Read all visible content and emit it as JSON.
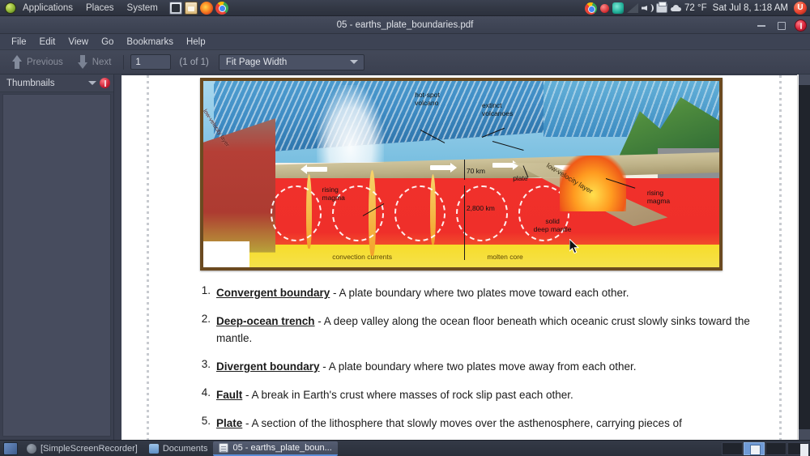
{
  "desktop_panel": {
    "menus": [
      "Applications",
      "Places",
      "System"
    ],
    "launchers": [
      "terminal-icon",
      "file-manager-icon",
      "firefox-icon",
      "chrome-icon"
    ],
    "tray_icons": [
      "chrome-icon",
      "recorder-icon",
      "sync-icon",
      "network-icon",
      "volume-icon",
      "printer-icon",
      "weather-cloud-icon"
    ],
    "temperature": "72 °F",
    "clock": "Sat Jul 8, 1:18 AM",
    "user_indicator": "U"
  },
  "window": {
    "title": "05 - earths_plate_boundaries.pdf",
    "controls": {
      "minimize": "minimize-button",
      "maximize": "maximize-button",
      "close": "close-button"
    }
  },
  "menubar": {
    "items": [
      "File",
      "Edit",
      "View",
      "Go",
      "Bookmarks",
      "Help"
    ]
  },
  "toolbar": {
    "previous_label": "Previous",
    "next_label": "Next",
    "page_value": "1",
    "page_placeholder": "1",
    "page_count": "(1 of 1)",
    "zoom_value": "Fit Page Width"
  },
  "sidebar": {
    "title": "Thumbnails",
    "dropdown": "chevron-down-icon",
    "close": "close-sidebar-button"
  },
  "document": {
    "figure": {
      "labels": [
        "hot-spot volcano",
        "extinct volcanoes",
        "low-velocity layer",
        "rising magma",
        "70 km",
        "2,800 km",
        "plate",
        "solid deep mantle",
        "rising magma",
        "convection currents",
        "molten core"
      ],
      "label_hotspot": "hot-spot\nvolcano",
      "label_extinct": "extinct\nvolcanoes",
      "label_lowvel_left": "low-velocity layer",
      "label_lowvel_right": "low-velocity layer",
      "label_rising_left": "rising\nmagma",
      "label_rising_right": "rising\nmagma",
      "label_70km": "70 km",
      "label_2800km": "2,800 km",
      "label_plate": "plate",
      "label_deepmantle": "solid\ndeep mantle",
      "label_convection": "convection currents",
      "label_molten": "molten core"
    },
    "list": [
      {
        "number": "1.",
        "term": "Convergent boundary",
        "definition": " - A plate boundary where two plates move toward each other."
      },
      {
        "number": "2.",
        "term": "Deep-ocean trench",
        "definition": " - A deep valley along the ocean floor beneath which oceanic crust slowly sinks toward the mantle."
      },
      {
        "number": "3.",
        "term": "Divergent boundary",
        "definition": " - A plate boundary where two plates move away from each other."
      },
      {
        "number": "4.",
        "term": "Fault",
        "definition": " - A break in Earth's crust where masses of rock slip past each other."
      },
      {
        "number": "5.",
        "term": "Plate",
        "definition": " - A section of the lithosphere that slowly moves over the asthenosphere, carrying pieces of"
      }
    ]
  },
  "taskbar": {
    "items": [
      {
        "label": "[SimpleScreenRecorder]",
        "icon": "recorder-icon",
        "active": false
      },
      {
        "label": "Documents",
        "icon": "folder-icon",
        "active": false
      },
      {
        "label": "05 - earths_plate_boun...",
        "icon": "pdf-icon",
        "active": true
      }
    ]
  },
  "colors": {
    "panel_bg": "#333845",
    "window_bg": "#3b4050",
    "sidebar_bg": "#474c5e",
    "accent": "#5b8dd6",
    "close_red": "#d7243a",
    "page_white": "#ffffff"
  }
}
